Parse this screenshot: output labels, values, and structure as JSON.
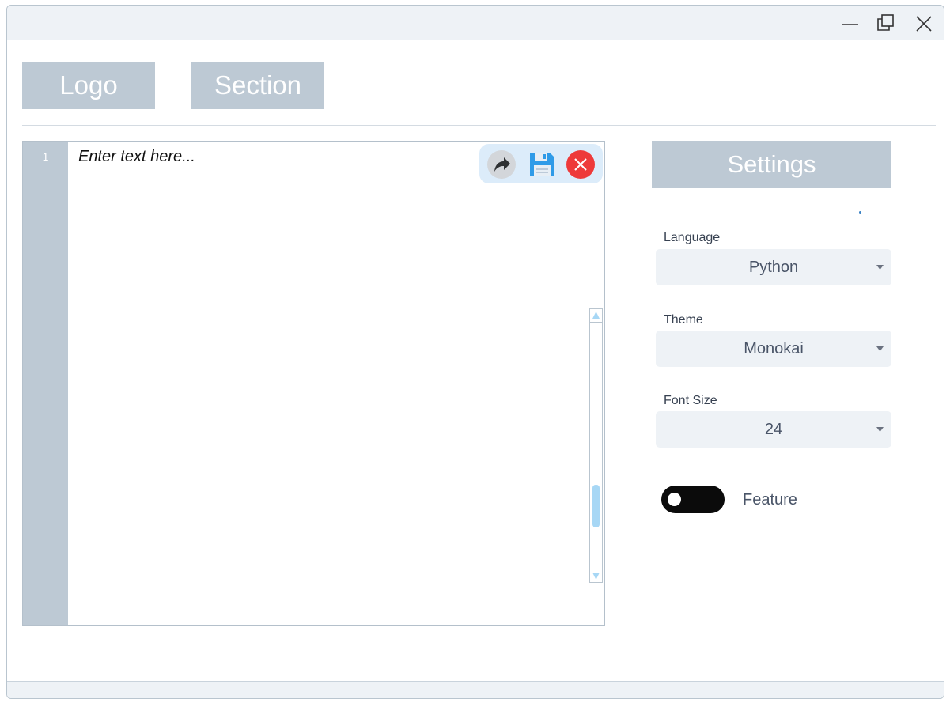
{
  "window": {
    "controls": {
      "minimize": "minimize-icon",
      "maximize": "maximize-icon",
      "close": "close-icon"
    }
  },
  "header": {
    "tabs": [
      {
        "label": "Logo"
      },
      {
        "label": "Section"
      }
    ]
  },
  "editor": {
    "line_number": "1",
    "placeholder": "Enter text here...",
    "toolbar": {
      "share_icon": "share-arrow-icon",
      "save_icon": "floppy-disk-icon",
      "close_icon": "red-close-icon"
    },
    "scroll_position": 0.72
  },
  "settings": {
    "title": "Settings",
    "language": {
      "label": "Language",
      "value": "Python"
    },
    "theme": {
      "label": "Theme",
      "value": "Monokai"
    },
    "font_size": {
      "label": "Font Size",
      "value": "24"
    },
    "feature": {
      "label": "Feature",
      "enabled": false
    }
  },
  "colors": {
    "accent_panel": "#bdc9d4",
    "select_bg": "#eef2f6",
    "toggle_bg": "#0b0b0b",
    "scroll_thumb": "#a7d7f5",
    "toolbar_bg": "#dcecfa",
    "close_red": "#ee3a3a",
    "save_blue": "#2f9be8"
  }
}
